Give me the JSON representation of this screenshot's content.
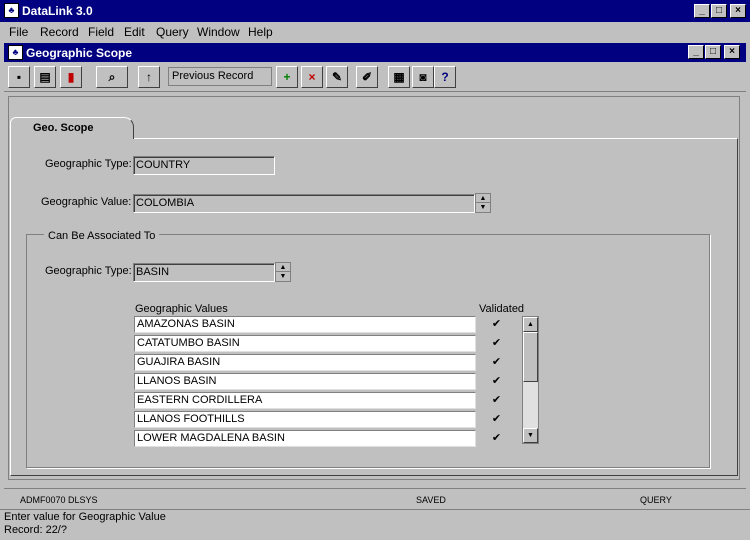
{
  "app": {
    "title": "DataLink 3.0"
  },
  "menu": [
    "File",
    "Record",
    "Field",
    "Edit",
    "Query",
    "Window",
    "Help"
  ],
  "window": {
    "title": "Geographic Scope"
  },
  "toolbar": {
    "previous_record": "Previous Record"
  },
  "tab": {
    "label": "Geo. Scope"
  },
  "form": {
    "geo_type_label": "Geographic Type:",
    "geo_type_value": "COUNTRY",
    "geo_value_label": "Geographic Value:",
    "geo_value_value": "COLOMBIA"
  },
  "assoc": {
    "group_label": "Can Be Associated To",
    "type_label": "Geographic Type:",
    "type_value": "BASIN",
    "values_header": "Geographic Values",
    "validated_header": "Validated",
    "rows": [
      {
        "value": "AMAZONAS BASIN",
        "validated": "✔"
      },
      {
        "value": "CATATUMBO BASIN",
        "validated": "✔"
      },
      {
        "value": "GUAJIRA BASIN",
        "validated": "✔"
      },
      {
        "value": "LLANOS BASIN",
        "validated": "✔"
      },
      {
        "value": "EASTERN CORDILLERA",
        "validated": "✔"
      },
      {
        "value": "LLANOS FOOTHILLS",
        "validated": "✔"
      },
      {
        "value": "LOWER MAGDALENA BASIN",
        "validated": "✔"
      }
    ]
  },
  "status": {
    "left": "ADMF0070 DLSYS",
    "center": "SAVED",
    "right": "QUERY"
  },
  "message": {
    "line1": "Enter value for Geographic Value",
    "line2": "Record: 22/?"
  }
}
